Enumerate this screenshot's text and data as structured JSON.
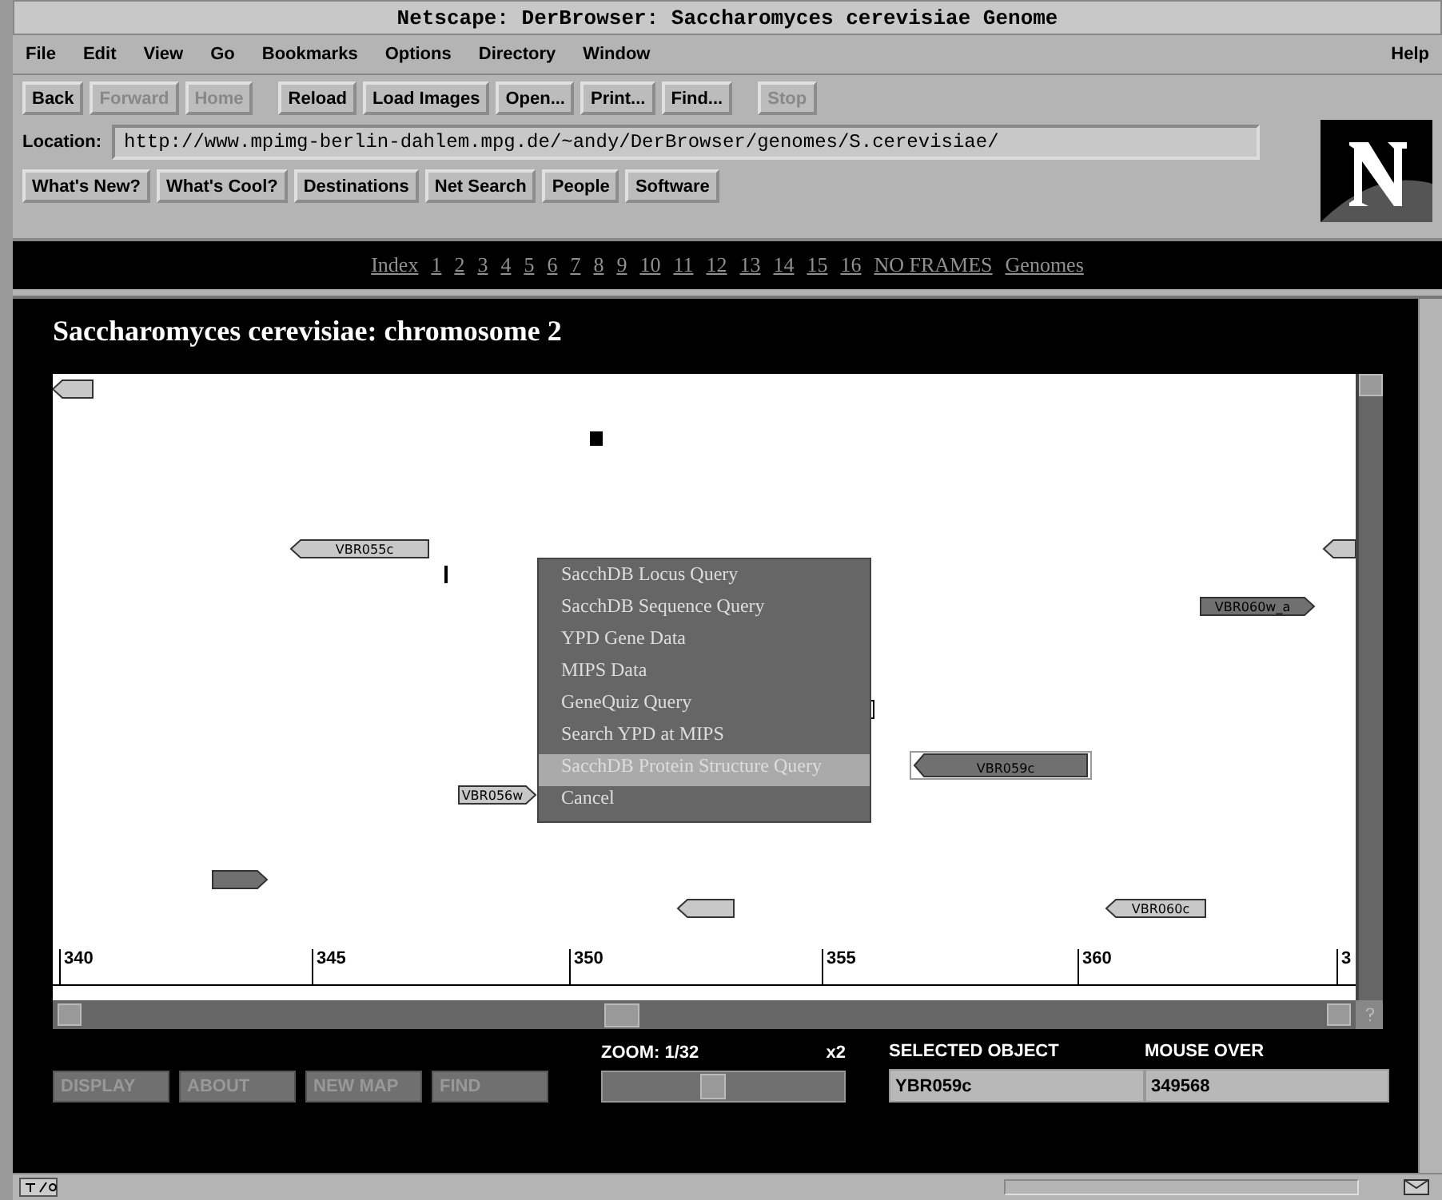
{
  "window": {
    "title": "Netscape: DerBrowser: Saccharomyces cerevisiae Genome"
  },
  "menu_bar": {
    "items": [
      "File",
      "Edit",
      "View",
      "Go",
      "Bookmarks",
      "Options",
      "Directory",
      "Window"
    ],
    "help": "Help"
  },
  "toolbar": [
    {
      "label": "Back",
      "disabled": false
    },
    {
      "label": "Forward",
      "disabled": true
    },
    {
      "label": "Home",
      "disabled": true
    },
    {
      "label": "Reload",
      "disabled": false
    },
    {
      "label": "Load Images",
      "disabled": false
    },
    {
      "label": "Open...",
      "disabled": false
    },
    {
      "label": "Print...",
      "disabled": false
    },
    {
      "label": "Find...",
      "disabled": false
    },
    {
      "label": "Stop",
      "disabled": true
    }
  ],
  "location": {
    "label": "Location:",
    "value": "http://www.mpimg-berlin-dahlem.mpg.de/~andy/DerBrowser/genomes/S.cerevisiae/"
  },
  "directory_buttons": [
    "What's New?",
    "What's Cool?",
    "Destinations",
    "Net Search",
    "People",
    "Software"
  ],
  "nav_links": [
    "Index",
    "1",
    "2",
    "3",
    "4",
    "5",
    "6",
    "7",
    "8",
    "9",
    "10",
    "11",
    "12",
    "13",
    "14",
    "15",
    "16",
    "NO FRAMES",
    "Genomes"
  ],
  "page": {
    "heading": "Saccharomyces cerevisiae: chromosome 2",
    "map": {
      "features": [
        {
          "kind": "gene",
          "leftward": true,
          "dark": false,
          "selected": false
        },
        {
          "kind": "block",
          "dark": true
        },
        {
          "kind": "gene",
          "label": "VBR055c",
          "leftward": true,
          "dark": false,
          "selected": false
        },
        {
          "kind": "gene",
          "leftward": true,
          "dark": false,
          "selected": false
        },
        {
          "kind": "tick"
        },
        {
          "kind": "gene",
          "label": "VBR060w_a",
          "leftward": false,
          "dark": true,
          "selected": false
        },
        {
          "kind": "block",
          "dark": false
        },
        {
          "kind": "gene",
          "label": "VBR059c",
          "leftward": true,
          "dark": true,
          "selected": true
        },
        {
          "kind": "gene",
          "label": "VBR056w",
          "leftward": false,
          "dark": false,
          "selected": false
        },
        {
          "kind": "gene",
          "leftward": false,
          "dark": true,
          "selected": false
        },
        {
          "kind": "gene",
          "leftward": true,
          "dark": false,
          "selected": false
        },
        {
          "kind": "gene",
          "label": "VBR060c",
          "leftward": true,
          "dark": false,
          "selected": false
        }
      ],
      "ruler": [
        "340",
        "345",
        "350",
        "355",
        "360",
        "3"
      ],
      "context_menu": [
        {
          "label": "SacchDB Locus Query",
          "selected": false
        },
        {
          "label": "SacchDB Sequence Query",
          "selected": false
        },
        {
          "label": "YPD Gene Data",
          "selected": false
        },
        {
          "label": "MIPS Data",
          "selected": false
        },
        {
          "label": "GeneQuiz Query",
          "selected": false
        },
        {
          "label": "Search YPD at MIPS",
          "selected": false
        },
        {
          "label": "SacchDB Protein Structure Query",
          "selected": true
        },
        {
          "label": "Cancel",
          "selected": false
        }
      ]
    },
    "controls": {
      "buttons": [
        "DISPLAY",
        "ABOUT",
        "NEW MAP",
        "FIND"
      ],
      "zoom": {
        "label": "ZOOM: 1/32",
        "factor": "x2",
        "level": 0.45
      },
      "selected_object": {
        "label": "SELECTED OBJECT",
        "value": "YBR059c"
      },
      "mouse_over": {
        "label": "MOUSE OVER",
        "value": "349568"
      }
    }
  },
  "status_bar": {
    "progress": {
      "level": 0
    }
  }
}
